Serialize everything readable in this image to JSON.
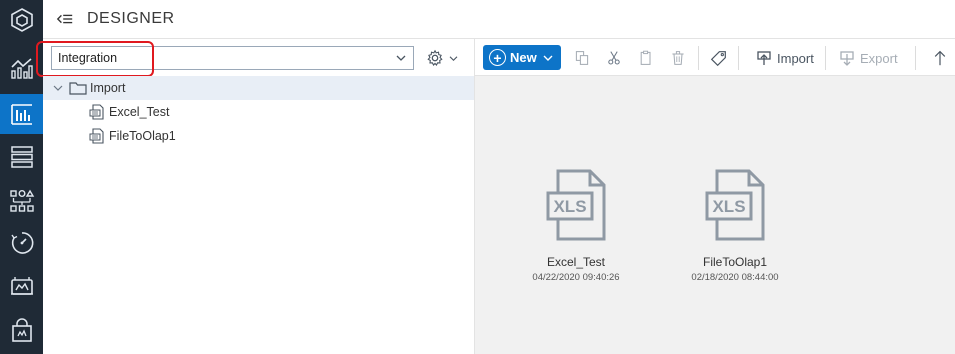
{
  "header": {
    "title": "DESIGNER"
  },
  "rail": {
    "items": [
      {
        "icon": "hexagon-logo-icon",
        "active": false
      },
      {
        "icon": "analytics-icon",
        "active": false
      },
      {
        "icon": "designer-icon",
        "active": true
      },
      {
        "icon": "server-list-icon",
        "active": false
      },
      {
        "icon": "flow-diagram-icon",
        "active": false
      },
      {
        "icon": "scheduler-icon",
        "active": false
      },
      {
        "icon": "monitor-icon",
        "active": false
      },
      {
        "icon": "store-icon",
        "active": false
      }
    ],
    "colors": {
      "background": "#1f2a36",
      "active": "#0d74c8"
    }
  },
  "left_pane": {
    "project_select": {
      "value": "Integration"
    },
    "tree": [
      {
        "label": "Import",
        "type": "folder",
        "expanded": true,
        "level": 0,
        "selected": true
      },
      {
        "label": "Excel_Test",
        "type": "file",
        "level": 1,
        "selected": false
      },
      {
        "label": "FileToOlap1",
        "type": "file",
        "level": 1,
        "selected": false
      }
    ]
  },
  "toolbar": {
    "new_label": "New",
    "import_label": "Import",
    "export_label": "Export"
  },
  "files": [
    {
      "name": "Excel_Test",
      "date": "04/22/2020 09:40:26",
      "badge": "XLS"
    },
    {
      "name": "FileToOlap1",
      "date": "02/18/2020 08:44:00",
      "badge": "XLS"
    }
  ],
  "colors": {
    "accent": "#0d74c8",
    "highlight": "#e0191f",
    "content_bg": "#f1f1f1"
  }
}
